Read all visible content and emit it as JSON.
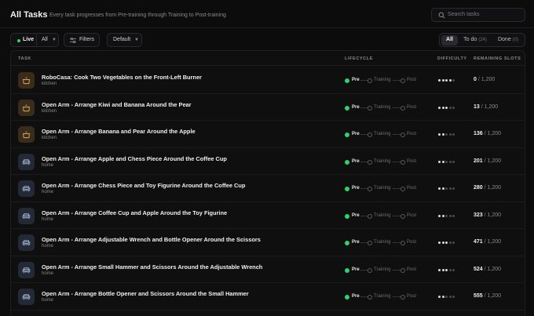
{
  "header": {
    "title": "All Tasks",
    "subtitle": "Every task progresses from Pre-training through Training to Post-training",
    "search_placeholder": "Search tasks"
  },
  "filters": {
    "live_label": "Live",
    "live_value": "All",
    "filters_label": "Filters",
    "sort_label": "Default"
  },
  "segments": [
    {
      "label": "All",
      "count": ""
    },
    {
      "label": "To do",
      "count": "(24)"
    },
    {
      "label": "Done",
      "count": "(0)"
    }
  ],
  "columns": {
    "task": "TASK",
    "lifecycle": "LIFECYCLE",
    "difficulty": "DIFFICULTY",
    "remaining": "REMAINING SLOTS"
  },
  "lifecycle_labels": [
    "Pre",
    "Training",
    "Post"
  ],
  "colors": {
    "live": "#2fd36b",
    "kitchen_icon": "#e0a85a",
    "home_icon": "#9fb0d0"
  },
  "tasks": [
    {
      "name": "RoboCasa: Cook Two Vegetables on the Front-Left Burner",
      "category": "kitchen",
      "icon": "pot-icon",
      "difficulty": 4,
      "done": "0",
      "total": "1,200"
    },
    {
      "name": "Open Arm - Arrange Kiwi and Banana Around the Pear",
      "category": "kitchen",
      "icon": "pot-icon",
      "difficulty": 3,
      "done": "13",
      "total": "1,200"
    },
    {
      "name": "Open Arm - Arrange Banana and Pear Around the Apple",
      "category": "kitchen",
      "icon": "pot-icon",
      "difficulty": 2,
      "done": "136",
      "total": "1,200"
    },
    {
      "name": "Open Arm - Arrange Apple and Chess Piece Around the Coffee Cup",
      "category": "home",
      "icon": "sofa-icon",
      "difficulty": 2,
      "done": "201",
      "total": "1,200"
    },
    {
      "name": "Open Arm - Arrange Chess Piece and Toy Figurine Around the Coffee Cup",
      "category": "home",
      "icon": "sofa-icon",
      "difficulty": 2,
      "done": "280",
      "total": "1,200"
    },
    {
      "name": "Open Arm - Arrange Coffee Cup and Apple Around the Toy Figurine",
      "category": "home",
      "icon": "sofa-icon",
      "difficulty": 2,
      "done": "323",
      "total": "1,200"
    },
    {
      "name": "Open Arm - Arrange Adjustable Wrench and Bottle Opener Around the Scissors",
      "category": "home",
      "icon": "sofa-icon",
      "difficulty": 3,
      "done": "471",
      "total": "1,200"
    },
    {
      "name": "Open Arm - Arrange Small Hammer and Scissors Around the Adjustable Wrench",
      "category": "home",
      "icon": "sofa-icon",
      "difficulty": 3,
      "done": "524",
      "total": "1,200"
    },
    {
      "name": "Open Arm - Arrange Bottle Opener and Scissors Around the Small Hammer",
      "category": "home",
      "icon": "sofa-icon",
      "difficulty": 2,
      "done": "555",
      "total": "1,200"
    }
  ]
}
